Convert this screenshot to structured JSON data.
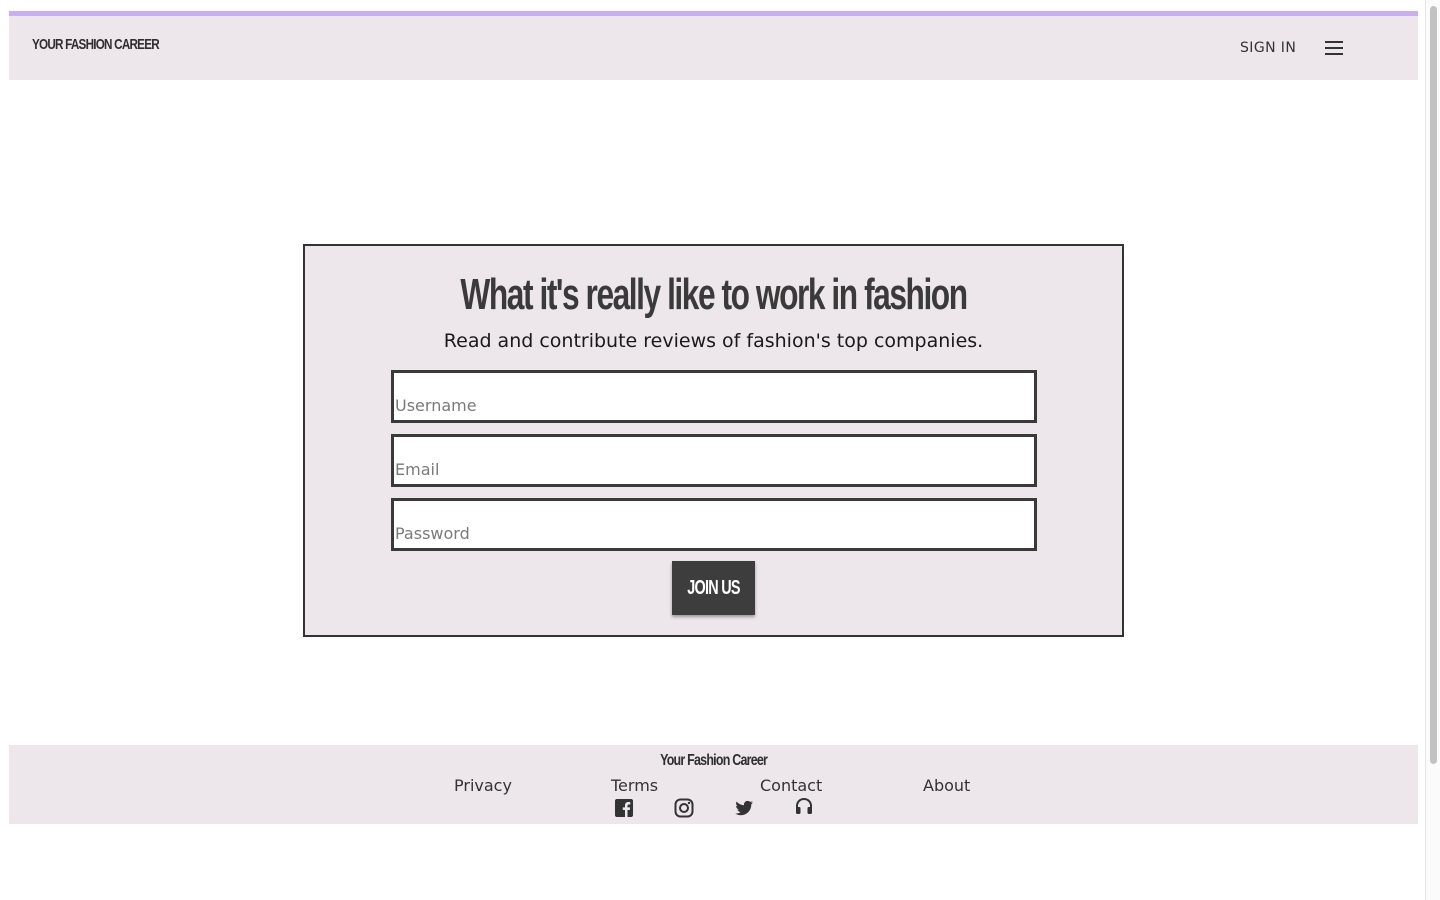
{
  "header": {
    "logo": "YOUR FASHION CAREER",
    "sign_in": "SIGN IN",
    "menu_icon": "hamburger-menu-icon",
    "accent_color": "#c8b0f0"
  },
  "signup": {
    "headline": "What it's really like to work in fashion",
    "subline": "Read and contribute reviews of fashion's top companies.",
    "username_placeholder": "Username",
    "email_placeholder": "Email",
    "password_placeholder": "Password",
    "submit_label": "JOIN US"
  },
  "footer": {
    "brand": "Your Fashion Career",
    "links": [
      "Privacy",
      "Terms",
      "Contact",
      "About"
    ],
    "social_icons": [
      "facebook-icon",
      "instagram-icon",
      "twitter-icon",
      "headphones-icon"
    ]
  },
  "colors": {
    "panel_background": "#ede6eb",
    "border": "#333333",
    "button": "#3d3d3d"
  }
}
